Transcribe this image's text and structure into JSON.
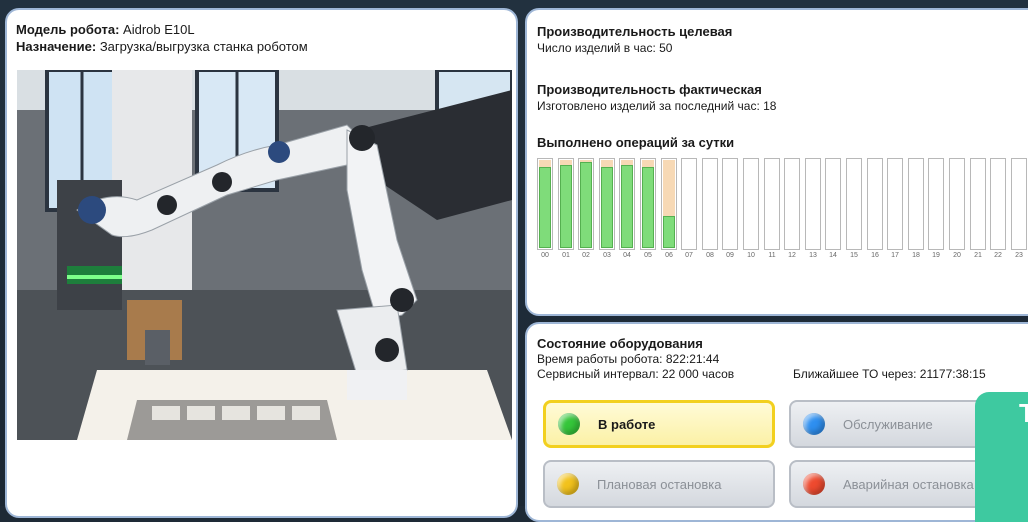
{
  "robot": {
    "model_label": "Модель робота:",
    "model_value": "Aidrob E10L",
    "purpose_label": "Назначение:",
    "purpose_value": "Загрузка/выгрузка станка роботом"
  },
  "productivity": {
    "target_title": "Производительность целевая",
    "target_text": "Число изделий в час: 50",
    "actual_title": "Производительность фактическая",
    "actual_text": "Изготовлено изделий за последний час: 18",
    "ops_title": "Выполнено операций за сутки"
  },
  "chart_data": {
    "type": "bar",
    "categories": [
      "00",
      "01",
      "02",
      "03",
      "04",
      "05",
      "06",
      "07",
      "08",
      "09",
      "10",
      "11",
      "12",
      "13",
      "14",
      "15",
      "16",
      "17",
      "18",
      "19",
      "20",
      "21",
      "22",
      "23"
    ],
    "values": [
      0.94,
      0.96,
      1.0,
      0.94,
      0.96,
      0.94,
      0.36,
      0,
      0,
      0,
      0,
      0,
      0,
      0,
      0,
      0,
      0,
      0,
      0,
      0,
      0,
      0,
      0,
      0
    ],
    "colors": {
      "done": "#7fdc7a",
      "planned": "#f7d9b5",
      "empty": "#ffffff"
    }
  },
  "equipment": {
    "title": "Состояние оборудования",
    "uptime": "Время работы робота: 822:21:44",
    "service_interval": "Сервисный интервал: 22 000 часов",
    "next_service": "Ближайшее ТО через: 21177:38:15"
  },
  "states": [
    {
      "label": "В работе",
      "color": "#35c63a",
      "active": true
    },
    {
      "label": "Обслуживание",
      "color": "#2e8ff0",
      "active": false
    },
    {
      "label": "Плановая остановка",
      "color": "#f2c21c",
      "active": false
    },
    {
      "label": "Аварийная остановка",
      "color": "#ee4a2f",
      "active": false
    }
  ],
  "tag_letter": "T"
}
